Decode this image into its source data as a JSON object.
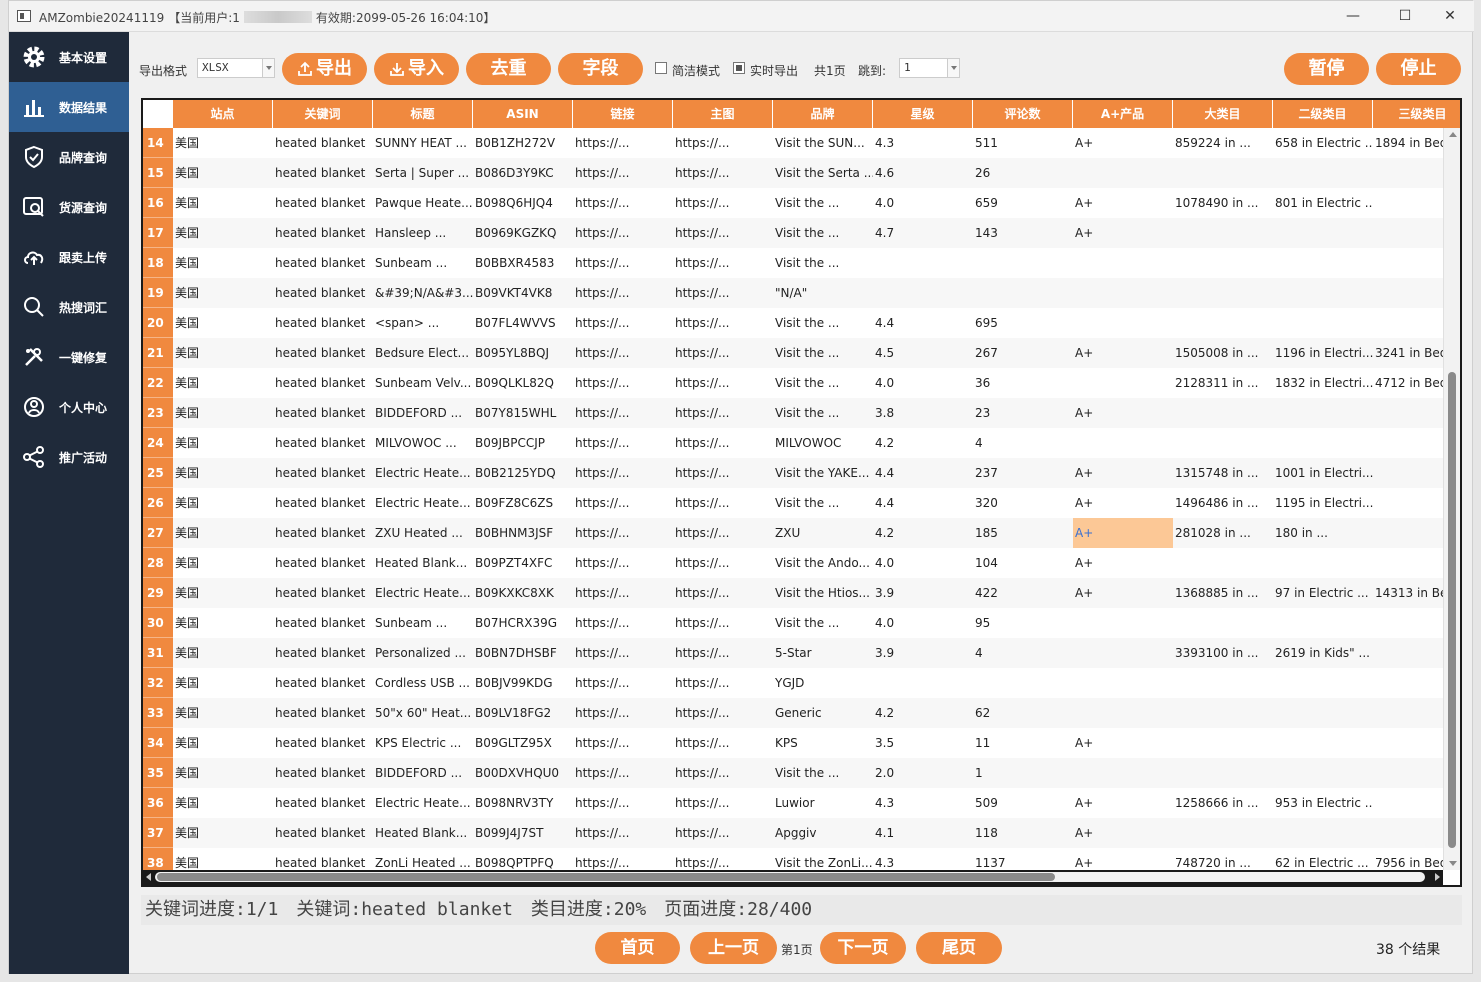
{
  "window": {
    "app_name": "AMZombie20241119",
    "user_label": "【当前用户:1",
    "expiry": "有效期:2099-05-26 16:04:10】",
    "minimize": "—",
    "maximize": "☐",
    "close": "✕"
  },
  "sidebar": {
    "items": [
      {
        "label": "基本设置",
        "icon": "gear-icon"
      },
      {
        "label": "数据结果",
        "icon": "bar-chart-icon"
      },
      {
        "label": "品牌查询",
        "icon": "shield-icon"
      },
      {
        "label": "货源查询",
        "icon": "search-box-icon"
      },
      {
        "label": "跟卖上传",
        "icon": "cloud-upload-icon"
      },
      {
        "label": "热搜词汇",
        "icon": "search-icon"
      },
      {
        "label": "一键修复",
        "icon": "wrench-icon"
      },
      {
        "label": "个人中心",
        "icon": "user-icon"
      },
      {
        "label": "推广活动",
        "icon": "share-icon"
      }
    ],
    "active_index": 1
  },
  "toolbar": {
    "format_label": "导出格式",
    "format_value": "XLSX",
    "export_label": "导出",
    "import_label": "导入",
    "dedupe_label": "去重",
    "fields_label": "字段",
    "simple_mode_label": "简洁模式",
    "realtime_export_label": "实时导出",
    "total_pages": "共1页",
    "jump_label": "跳到:",
    "jump_value": "1",
    "pause_label": "暂停",
    "stop_label": "停止"
  },
  "table": {
    "columns": [
      "站点",
      "关键词",
      "标题",
      "ASIN",
      "链接",
      "主图",
      "品牌",
      "星级",
      "评论数",
      "A+产品",
      "大类目",
      "二级类目",
      "三级类目"
    ],
    "rows": [
      [
        "14",
        "美国",
        "heated blanket",
        "SUNNY HEAT ...",
        "B0B1ZH272V",
        "https://...",
        "https://...",
        "Visit the SUN...",
        "4.3",
        "511",
        "A+",
        "859224 in ...",
        "658 in Electric ...",
        "1894 in Bed"
      ],
      [
        "15",
        "美国",
        "heated blanket",
        "Serta | Super ...",
        "B086D3Y9KC",
        "https://...",
        "https://...",
        "Visit the Serta ...",
        "4.6",
        "26",
        "",
        "",
        "",
        ""
      ],
      [
        "16",
        "美国",
        "heated blanket",
        "Pawque Heate...",
        "B098Q6HJQ4",
        "https://...",
        "https://...",
        "Visit the ...",
        "4.0",
        "659",
        "A+",
        "1078490 in ...",
        "801 in Electric ...",
        ""
      ],
      [
        "17",
        "美国",
        "heated blanket",
        "Hansleep ...",
        "B0969KGZKQ",
        "https://...",
        "https://...",
        "Visit the ...",
        "4.7",
        "143",
        "A+",
        "",
        "",
        ""
      ],
      [
        "18",
        "美国",
        "heated blanket",
        "Sunbeam ...",
        "B0BBXR4583",
        "https://...",
        "https://...",
        "Visit the ...",
        "",
        "",
        "",
        "",
        "",
        ""
      ],
      [
        "19",
        "美国",
        "heated blanket",
        "&#39;N/A&#3...",
        "B09VKT4VK8",
        "https://...",
        "https://...",
        "\"N/A\"",
        "",
        "",
        "",
        "",
        "",
        ""
      ],
      [
        "20",
        "美国",
        "heated blanket",
        "<span>      ...",
        "B07FL4WVVS",
        "https://...",
        "https://...",
        "Visit the ...",
        "4.4",
        "695",
        "",
        "",
        "",
        ""
      ],
      [
        "21",
        "美国",
        "heated blanket",
        "Bedsure Elect...",
        "B095YL8BQJ",
        "https://...",
        "https://...",
        "Visit the ...",
        "4.5",
        "267",
        "A+",
        "1505008 in ...",
        "1196 in Electri...",
        "3241 in Bed"
      ],
      [
        "22",
        "美国",
        "heated blanket",
        "Sunbeam Velv...",
        "B09QLKL82Q",
        "https://...",
        "https://...",
        "Visit the ...",
        "4.0",
        "36",
        "",
        "2128311 in ...",
        "1832 in Electri...",
        "4712 in Bed"
      ],
      [
        "23",
        "美国",
        "heated blanket",
        "BIDDEFORD ...",
        "B07Y815WHL",
        "https://...",
        "https://...",
        "Visit the ...",
        "3.8",
        "23",
        "A+",
        "",
        "",
        ""
      ],
      [
        "24",
        "美国",
        "heated blanket",
        "MILVOWOC ...",
        "B09JBPCCJP",
        "https://...",
        "https://...",
        "MILVOWOC",
        "4.2",
        "4",
        "",
        "",
        "",
        ""
      ],
      [
        "25",
        "美国",
        "heated blanket",
        "Electric Heate...",
        "B0B2125YDQ",
        "https://...",
        "https://...",
        "Visit the YAKE...",
        "4.4",
        "237",
        "A+",
        "1315748 in ...",
        "1001 in Electri...",
        ""
      ],
      [
        "26",
        "美国",
        "heated blanket",
        "Electric Heate...",
        "B09FZ8C6ZS",
        "https://...",
        "https://...",
        "Visit the ...",
        "4.4",
        "320",
        "A+",
        "1496486 in ...",
        "1195 in Electri...",
        ""
      ],
      [
        "27",
        "美国",
        "heated blanket",
        "ZXU Heated ...",
        "B0BHNM3JSF",
        "https://...",
        "https://...",
        "ZXU",
        "4.2",
        "185",
        "A+",
        "281028 in ...",
        "180 in ...",
        ""
      ],
      [
        "28",
        "美国",
        "heated blanket",
        "Heated Blank...",
        "B09PZT4XFC",
        "https://...",
        "https://...",
        "Visit the Ando...",
        "4.0",
        "104",
        "A+",
        "",
        "",
        ""
      ],
      [
        "29",
        "美国",
        "heated blanket",
        "Electric Heate...",
        "B09KXKC8XK",
        "https://...",
        "https://...",
        "Visit the Htios...",
        "3.9",
        "422",
        "A+",
        "1368885 in ...",
        "97 in Electric ...",
        "14313 in Be"
      ],
      [
        "30",
        "美国",
        "heated blanket",
        "Sunbeam ...",
        "B07HCRX39G",
        "https://...",
        "https://...",
        "Visit the ...",
        "4.0",
        "95",
        "",
        "",
        "",
        ""
      ],
      [
        "31",
        "美国",
        "heated blanket",
        "Personalized ...",
        "B0BN7DHSBF",
        "https://...",
        "https://...",
        "5-Star",
        "3.9",
        "4",
        "",
        "3393100 in ...",
        "2619 in Kids\" ...",
        ""
      ],
      [
        "32",
        "美国",
        "heated blanket",
        "Cordless USB ...",
        "B0BJV99KDG",
        "https://...",
        "https://...",
        "YGJD",
        "",
        "",
        "",
        "",
        "",
        ""
      ],
      [
        "33",
        "美国",
        "heated blanket",
        "50\"x 60\" Heat...",
        "B09LV18FG2",
        "https://...",
        "https://...",
        "Generic",
        "4.2",
        "62",
        "",
        "",
        "",
        ""
      ],
      [
        "34",
        "美国",
        "heated blanket",
        "KPS Electric ...",
        "B09GLTZ95X",
        "https://...",
        "https://...",
        "KPS",
        "3.5",
        "11",
        "A+",
        "",
        "",
        ""
      ],
      [
        "35",
        "美国",
        "heated blanket",
        "BIDDEFORD ...",
        "B00DXVHQU0",
        "https://...",
        "https://...",
        "Visit the ...",
        "2.0",
        "1",
        "",
        "",
        "",
        ""
      ],
      [
        "36",
        "美国",
        "heated blanket",
        "Electric Heate...",
        "B098NRV3TY",
        "https://...",
        "https://...",
        "Luwior",
        "4.3",
        "509",
        "A+",
        "1258666 in ...",
        "953 in Electric ...",
        ""
      ],
      [
        "37",
        "美国",
        "heated blanket",
        "Heated Blank...",
        "B099J4J7ST",
        "https://...",
        "https://...",
        "Apggiv",
        "4.1",
        "118",
        "A+",
        "",
        "",
        ""
      ],
      [
        "38",
        "美国",
        "heated blanket",
        "ZonLi Heated ...",
        "B098QPTPFQ",
        "https://...",
        "https://...",
        "Visit the ZonLi...",
        "4.3",
        "1137",
        "A+",
        "748720 in ...",
        "62 in Electric ...",
        "7956 in Bed"
      ]
    ],
    "selected_row": "27",
    "selected_column": "A+产品"
  },
  "status": {
    "keyword_progress": "关键词进度:1/1",
    "keyword": "关键词:heated blanket",
    "category_progress": "类目进度:20%",
    "page_progress": "页面进度:28/400"
  },
  "pager": {
    "first": "首页",
    "prev": "上一页",
    "current": "第1页",
    "next": "下一页",
    "last": "尾页",
    "results": "38 个结果"
  },
  "colors": {
    "accent": "#f0893f",
    "sidebar_bg": "#1f2a3a",
    "sidebar_active": "#2f5f93",
    "selected_cell": "#fcc896"
  }
}
